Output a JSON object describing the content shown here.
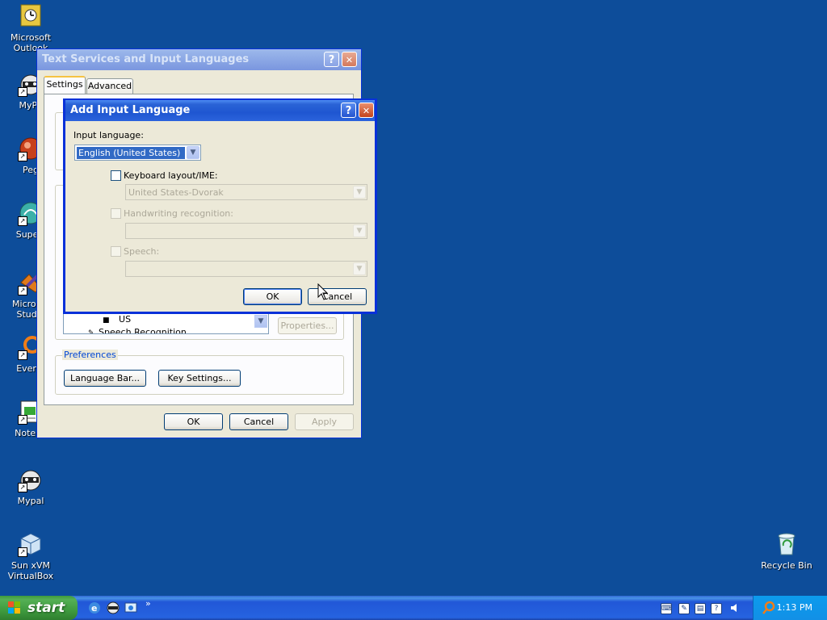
{
  "desktop": {
    "icons": [
      {
        "label": "Microsoft Outlook",
        "icon": "outlook-icon"
      },
      {
        "label": "MyPa",
        "icon": "raccoon-icon"
      },
      {
        "label": "Peg",
        "icon": "pegasus-icon"
      },
      {
        "label": "Superr",
        "icon": "superr-icon"
      },
      {
        "label": "Microsof Studio",
        "icon": "visual-studio-icon"
      },
      {
        "label": "Everyt",
        "icon": "everything-search-icon"
      },
      {
        "label": "Notepa",
        "icon": "notepad-icon"
      },
      {
        "label": "Mypal",
        "icon": "raccoon-icon"
      },
      {
        "label": "Sun xVM VirtualBox",
        "icon": "virtualbox-icon"
      },
      {
        "label": "Recycle Bin",
        "icon": "recycle-bin-icon"
      }
    ]
  },
  "text_services_window": {
    "title": "Text Services and Input Languages",
    "help_glyph": "?",
    "close_glyph": "✕",
    "tabs": [
      "Settings",
      "Advanced"
    ],
    "installed_service_item": "US",
    "truncated_item": "Speech Recognition",
    "properties_label": "Properties...",
    "preferences_legend": "Preferences",
    "language_bar_label": "Language Bar...",
    "key_settings_label": "Key Settings...",
    "ok_label": "OK",
    "cancel_label": "Cancel",
    "apply_label": "Apply"
  },
  "add_input_language_dialog": {
    "title": "Add Input Language",
    "help_glyph": "?",
    "close_glyph": "✕",
    "input_language_label": "Input language:",
    "input_language_value": "English (United States)",
    "keyboard_layout_label": "Keyboard layout/IME:",
    "keyboard_layout_checked": false,
    "keyboard_layout_value": "United States-Dvorak",
    "handwriting_label": "Handwriting recognition:",
    "handwriting_value": "",
    "speech_label": "Speech:",
    "speech_value": "",
    "ok_label": "OK",
    "cancel_label": "Cancel"
  },
  "taskbar": {
    "start_label": "start",
    "quicklaunch_expand": "»",
    "clock": "1:13 PM",
    "tray_icons": [
      "keyboard-icon",
      "pen-icon",
      "language-bar-icon",
      "help-icon",
      "volume-icon"
    ]
  },
  "colors": {
    "desktop_bg": "#0d4d9a",
    "title_active": "#2a63d6",
    "window_face": "#ece9d8",
    "start_green": "#3f9b3f"
  }
}
